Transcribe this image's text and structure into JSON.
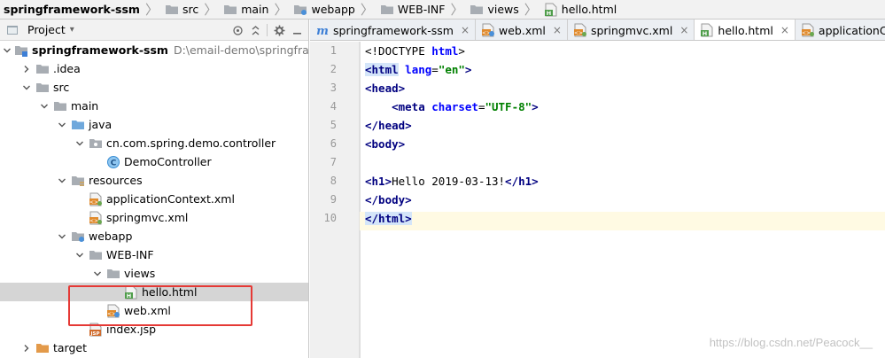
{
  "breadcrumbs": [
    {
      "label": "springframework-ssm",
      "icon": "project-icon"
    },
    {
      "label": "src",
      "icon": "folder-icon"
    },
    {
      "label": "main",
      "icon": "folder-icon"
    },
    {
      "label": "webapp",
      "icon": "webapp-folder-icon"
    },
    {
      "label": "WEB-INF",
      "icon": "folder-icon"
    },
    {
      "label": "views",
      "icon": "folder-icon"
    },
    {
      "label": "hello.html",
      "icon": "html-file-icon"
    }
  ],
  "project_panel": {
    "title": "Project",
    "tree": [
      {
        "label": "springframework-ssm",
        "hint": "D:\\email-demo\\springframew",
        "depth": 0,
        "expanded": true,
        "icon": "module-folder-icon",
        "bold": true
      },
      {
        "label": ".idea",
        "depth": 1,
        "expanded": false,
        "icon": "folder-icon"
      },
      {
        "label": "src",
        "depth": 1,
        "expanded": true,
        "icon": "folder-icon"
      },
      {
        "label": "main",
        "depth": 2,
        "expanded": true,
        "icon": "folder-icon"
      },
      {
        "label": "java",
        "depth": 3,
        "expanded": true,
        "icon": "source-folder-icon"
      },
      {
        "label": "cn.com.spring.demo.controller",
        "depth": 4,
        "expanded": true,
        "icon": "package-icon"
      },
      {
        "label": "DemoController",
        "depth": 5,
        "icon": "class-icon"
      },
      {
        "label": "resources",
        "depth": 3,
        "expanded": true,
        "icon": "resources-folder-icon"
      },
      {
        "label": "applicationContext.xml",
        "depth": 4,
        "icon": "xml-file-icon"
      },
      {
        "label": "springmvc.xml",
        "depth": 4,
        "icon": "xml-file-icon"
      },
      {
        "label": "webapp",
        "depth": 3,
        "expanded": true,
        "icon": "webapp-folder-icon"
      },
      {
        "label": "WEB-INF",
        "depth": 4,
        "expanded": true,
        "icon": "folder-icon"
      },
      {
        "label": "views",
        "depth": 5,
        "expanded": true,
        "icon": "folder-icon"
      },
      {
        "label": "hello.html",
        "depth": 6,
        "icon": "html-file-icon",
        "selected": true
      },
      {
        "label": "web.xml",
        "depth": 5,
        "icon": "web-xml-icon"
      },
      {
        "label": "index.jsp",
        "depth": 4,
        "icon": "jsp-file-icon"
      },
      {
        "label": "target",
        "depth": 1,
        "expanded": false,
        "icon": "target-folder-icon"
      }
    ]
  },
  "editor_tabs": [
    {
      "label": "springframework-ssm",
      "icon": "maven-icon",
      "active": false
    },
    {
      "label": "web.xml",
      "icon": "web-xml-icon",
      "active": false
    },
    {
      "label": "springmvc.xml",
      "icon": "xml-file-icon",
      "active": false
    },
    {
      "label": "hello.html",
      "icon": "html-file-icon",
      "active": true
    },
    {
      "label": "applicationContext.x",
      "icon": "xml-file-icon",
      "active": false
    }
  ],
  "code": {
    "line_numbers": [
      "1",
      "2",
      "3",
      "4",
      "5",
      "6",
      "7",
      "8",
      "9",
      "10"
    ],
    "lines": [
      [
        {
          "t": "<!DOCTYPE ",
          "c": "plain"
        },
        {
          "t": "html",
          "c": "attr"
        },
        {
          "t": ">",
          "c": "plain"
        }
      ],
      [
        {
          "t": "<html",
          "c": "tag",
          "hl": true
        },
        {
          "t": " ",
          "c": "plain"
        },
        {
          "t": "lang",
          "c": "attr"
        },
        {
          "t": "=",
          "c": "plain"
        },
        {
          "t": "\"en\"",
          "c": "str"
        },
        {
          "t": ">",
          "c": "tag"
        }
      ],
      [
        {
          "t": "<head",
          "c": "tag"
        },
        {
          "t": ">",
          "c": "tag"
        }
      ],
      [
        {
          "t": "    ",
          "c": "plain"
        },
        {
          "t": "<meta ",
          "c": "tag"
        },
        {
          "t": "charset",
          "c": "attr"
        },
        {
          "t": "=",
          "c": "plain"
        },
        {
          "t": "\"UTF-8\"",
          "c": "str"
        },
        {
          "t": ">",
          "c": "tag"
        }
      ],
      [
        {
          "t": "</head>",
          "c": "tag"
        }
      ],
      [
        {
          "t": "<body>",
          "c": "tag"
        }
      ],
      [
        {
          "t": "",
          "c": "plain"
        }
      ],
      [
        {
          "t": "<h1>",
          "c": "tag"
        },
        {
          "t": "Hello 2019-03-13!",
          "c": "plain"
        },
        {
          "t": "</h1>",
          "c": "tag"
        }
      ],
      [
        {
          "t": "</body>",
          "c": "tag"
        }
      ],
      [
        {
          "t": "</html>",
          "c": "tag",
          "hl": true
        }
      ]
    ],
    "current_line": "10"
  },
  "watermark": "https://blog.csdn.net/Peacock__",
  "colors": {
    "selection_row": "#d5d5d5",
    "red_box": "#e53935",
    "tag": "#000080",
    "attr": "#0000ff",
    "string": "#008000"
  }
}
